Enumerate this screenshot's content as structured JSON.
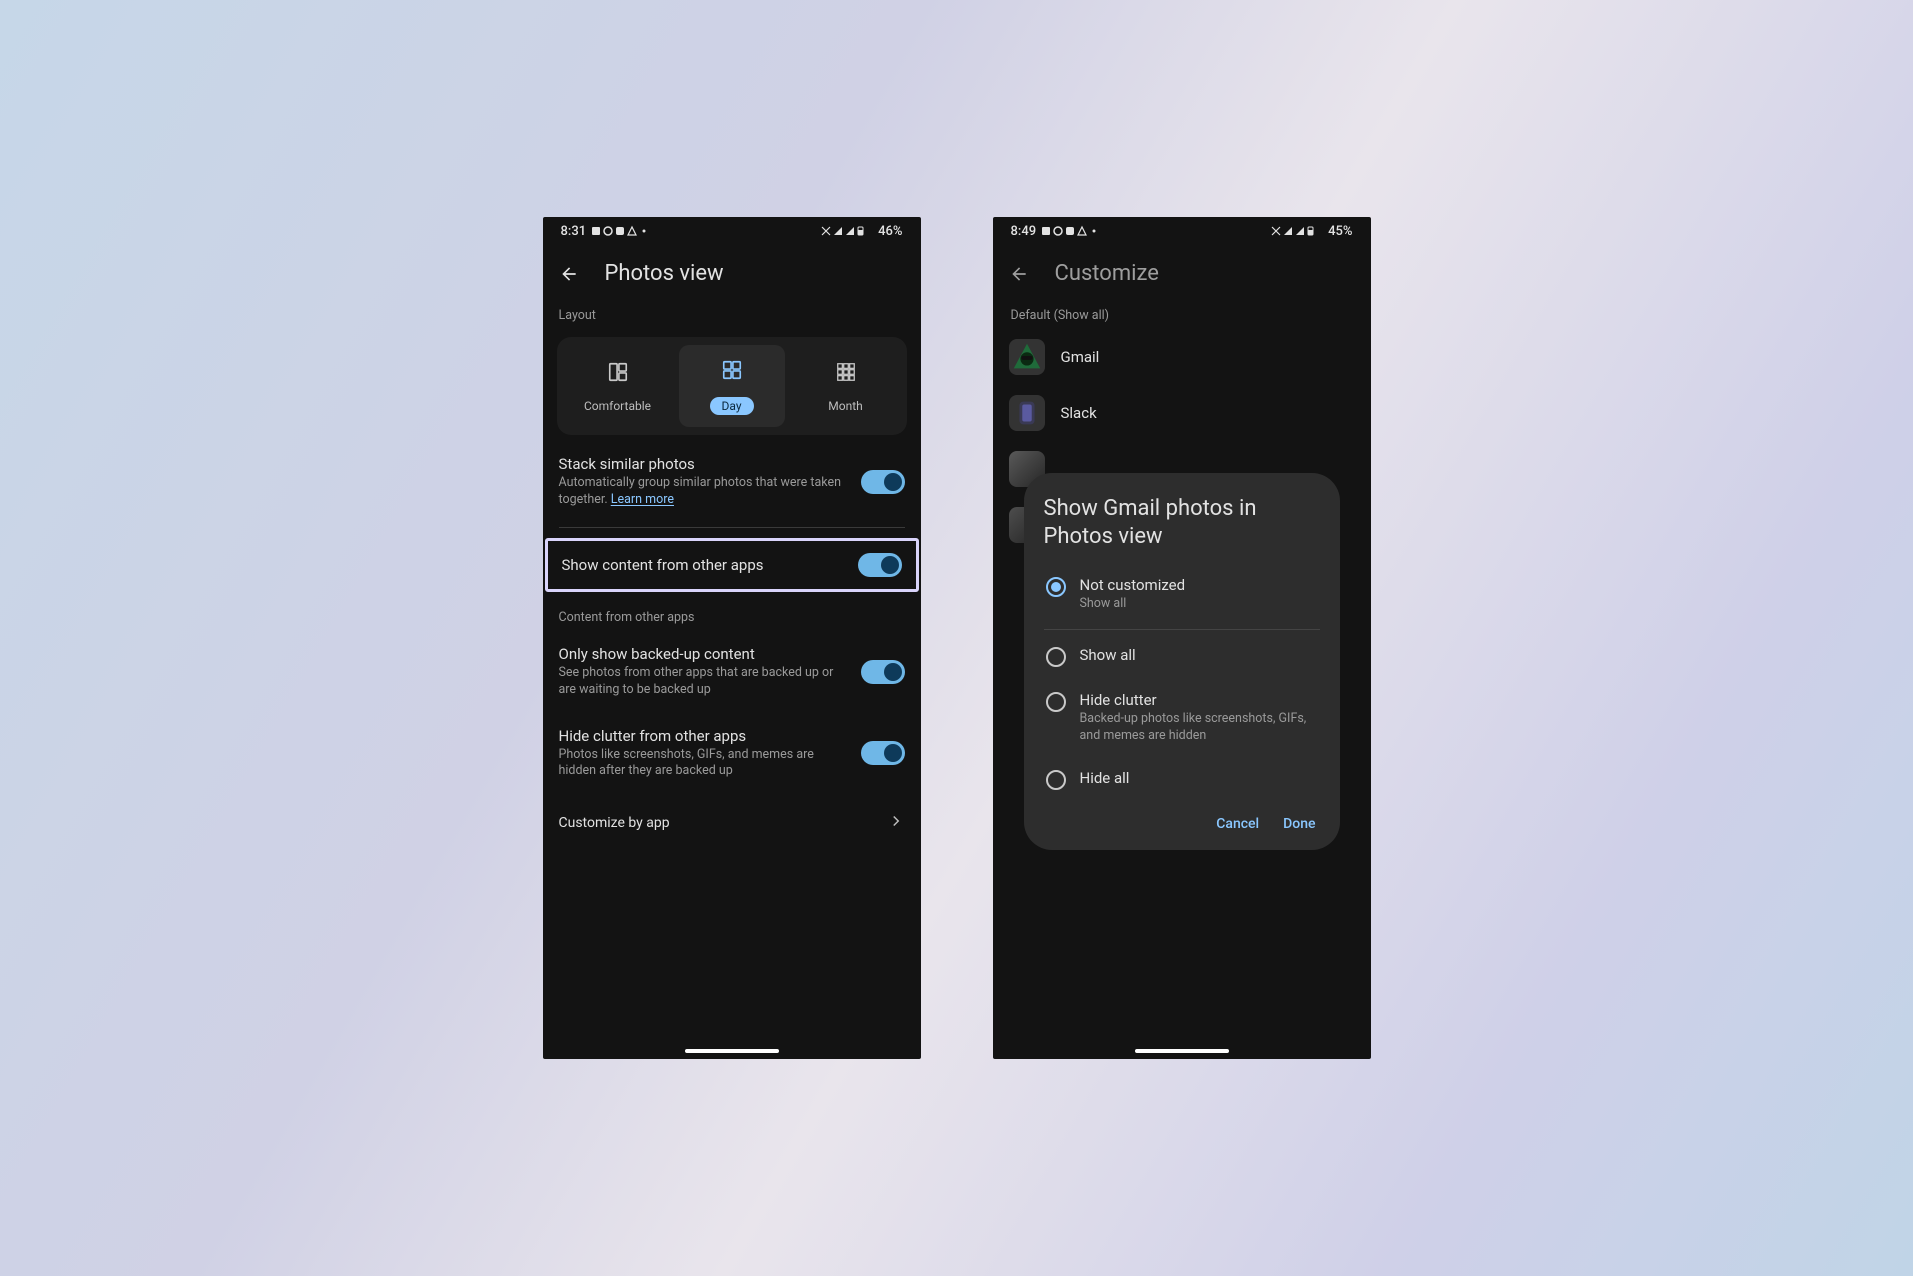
{
  "left": {
    "status": {
      "time": "8:31",
      "battery": "46%"
    },
    "appbar_title": "Photos view",
    "section_layout": "Layout",
    "layout_opts": {
      "comfortable": "Comfortable",
      "day": "Day",
      "month": "Month"
    },
    "stack": {
      "title": "Stack similar photos",
      "sub_a": "Automatically group similar photos that were taken together. ",
      "learn_more": "Learn more"
    },
    "show_other_apps": "Show content from other apps",
    "section_content": "Content from other apps",
    "only_backed": {
      "title": "Only show backed-up content",
      "sub": "See photos from other apps that are backed up or are waiting to be backed up"
    },
    "hide_clutter": {
      "title": "Hide clutter from other apps",
      "sub": "Photos like screenshots, GIFs, and memes are hidden after they are backed up"
    },
    "customize_by_app": "Customize by app"
  },
  "right": {
    "status": {
      "time": "8:49",
      "battery": "45%"
    },
    "appbar_title": "Customize",
    "default_label": "Default (Show all)",
    "apps": {
      "gmail": "Gmail",
      "slack": "Slack"
    },
    "sheet": {
      "title": "Show Gmail photos in Photos view",
      "opt_not_customized": {
        "title": "Not customized",
        "sub": "Show all"
      },
      "opt_show_all": "Show all",
      "opt_hide_clutter": {
        "title": "Hide clutter",
        "sub": "Backed-up photos like screenshots, GIFs, and memes are hidden"
      },
      "opt_hide_all": "Hide all",
      "cancel": "Cancel",
      "done": "Done"
    }
  }
}
